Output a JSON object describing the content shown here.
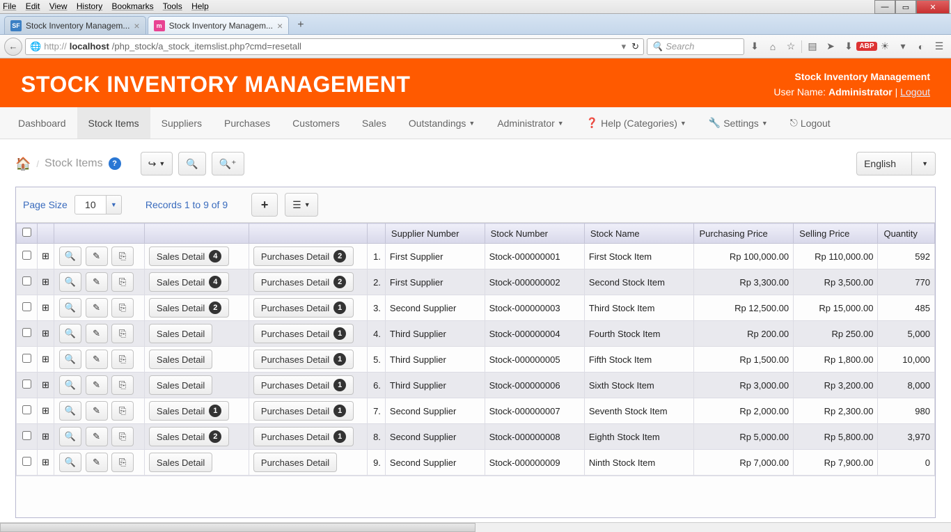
{
  "os_menu": [
    "File",
    "Edit",
    "View",
    "History",
    "Bookmarks",
    "Tools",
    "Help"
  ],
  "browser": {
    "tabs": [
      {
        "label": "Stock Inventory Managem...",
        "favicon": "SF"
      },
      {
        "label": "Stock Inventory Managem...",
        "favicon": "m"
      }
    ],
    "url_prefix": "http://",
    "url_host": "localhost",
    "url_path": "/php_stock/a_stock_itemslist.php?cmd=resetall",
    "search_placeholder": "Search"
  },
  "app": {
    "title": "STOCK INVENTORY MANAGEMENT",
    "brand": "Stock Inventory Management",
    "user_label": "User Name:",
    "user_name": "Administrator",
    "logout": "Logout"
  },
  "nav": {
    "items": [
      "Dashboard",
      "Stock Items",
      "Suppliers",
      "Purchases",
      "Customers",
      "Sales",
      "Outstandings",
      "Administrator",
      "Help (Categories)",
      "Settings",
      "Logout"
    ]
  },
  "crumb": {
    "label": "Stock Items"
  },
  "language": "English",
  "grid": {
    "page_size_label": "Page Size",
    "page_size": "10",
    "records_label": "Records 1 to 9 of 9",
    "add_label": "+",
    "columns": [
      "Supplier Number",
      "Stock Number",
      "Stock Name",
      "Purchasing Price",
      "Selling Price",
      "Quantity"
    ],
    "sales_label": "Sales Detail",
    "purchases_label": "Purchases Detail",
    "rows": [
      {
        "sales": 4,
        "purchases": 2,
        "supplier": "First Supplier",
        "stock_no": "Stock-000000001",
        "name": "First Stock Item",
        "buy": "Rp 100,000.00",
        "sell": "Rp 110,000.00",
        "qty": "592"
      },
      {
        "sales": 4,
        "purchases": 2,
        "supplier": "First Supplier",
        "stock_no": "Stock-000000002",
        "name": "Second Stock Item",
        "buy": "Rp 3,300.00",
        "sell": "Rp 3,500.00",
        "qty": "770"
      },
      {
        "sales": 2,
        "purchases": 1,
        "supplier": "Second Supplier",
        "stock_no": "Stock-000000003",
        "name": "Third Stock Item",
        "buy": "Rp 12,500.00",
        "sell": "Rp 15,000.00",
        "qty": "485"
      },
      {
        "sales": 0,
        "purchases": 1,
        "supplier": "Third Supplier",
        "stock_no": "Stock-000000004",
        "name": "Fourth Stock Item",
        "buy": "Rp 200.00",
        "sell": "Rp 250.00",
        "qty": "5,000"
      },
      {
        "sales": 0,
        "purchases": 1,
        "supplier": "Third Supplier",
        "stock_no": "Stock-000000005",
        "name": "Fifth Stock Item",
        "buy": "Rp 1,500.00",
        "sell": "Rp 1,800.00",
        "qty": "10,000"
      },
      {
        "sales": 0,
        "purchases": 1,
        "supplier": "Third Supplier",
        "stock_no": "Stock-000000006",
        "name": "Sixth Stock Item",
        "buy": "Rp 3,000.00",
        "sell": "Rp 3,200.00",
        "qty": "8,000"
      },
      {
        "sales": 1,
        "purchases": 1,
        "supplier": "Second Supplier",
        "stock_no": "Stock-000000007",
        "name": "Seventh Stock Item",
        "buy": "Rp 2,000.00",
        "sell": "Rp 2,300.00",
        "qty": "980"
      },
      {
        "sales": 2,
        "purchases": 1,
        "supplier": "Second Supplier",
        "stock_no": "Stock-000000008",
        "name": "Eighth Stock Item",
        "buy": "Rp 5,000.00",
        "sell": "Rp 5,800.00",
        "qty": "3,970"
      },
      {
        "sales": 0,
        "purchases": 0,
        "supplier": "Second Supplier",
        "stock_no": "Stock-000000009",
        "name": "Ninth Stock Item",
        "buy": "Rp 7,000.00",
        "sell": "Rp 7,900.00",
        "qty": "0"
      }
    ]
  }
}
